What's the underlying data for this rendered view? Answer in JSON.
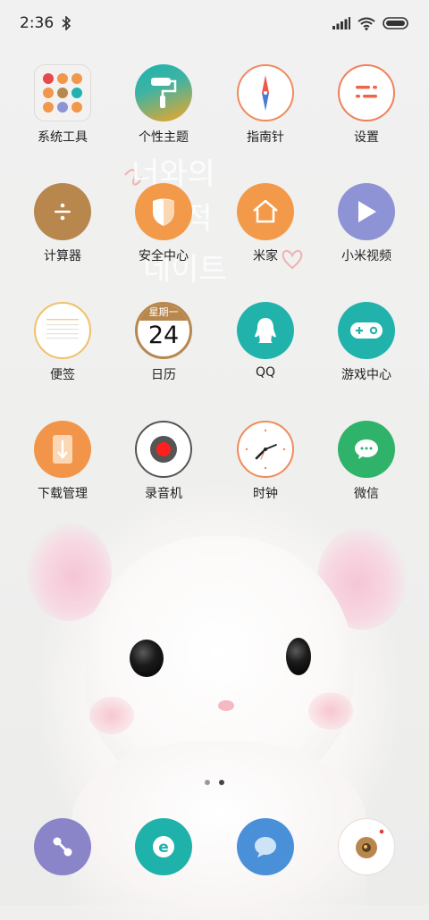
{
  "status_bar": {
    "time": "2:36"
  },
  "apps": [
    {
      "label": "系统工具"
    },
    {
      "label": "个性主题"
    },
    {
      "label": "指南针"
    },
    {
      "label": "设置"
    },
    {
      "label": "计算器"
    },
    {
      "label": "安全中心"
    },
    {
      "label": "米家"
    },
    {
      "label": "小米视频"
    },
    {
      "label": "便签"
    },
    {
      "label": "日历",
      "weekday": "星期一",
      "day": "24"
    },
    {
      "label": "QQ"
    },
    {
      "label": "游戏中心"
    },
    {
      "label": "下载管理"
    },
    {
      "label": "录音机"
    },
    {
      "label": "时钟"
    },
    {
      "label": "微信"
    }
  ],
  "page_indicator": {
    "pages": 2,
    "current": 2
  },
  "dock": [
    {
      "icon": "phone-icon"
    },
    {
      "icon": "browser-icon"
    },
    {
      "icon": "messages-icon"
    },
    {
      "icon": "camera-icon"
    }
  ],
  "wallpaper": {
    "scribble_lines": [
      "너와의",
      "기적",
      "네이트"
    ]
  },
  "colors": {
    "calculator": "#b8874d",
    "security": "#f29a4a",
    "mijia": "#f29a4a",
    "video": "#8e93d6",
    "qq": "#21b3ab",
    "game": "#21b3ab",
    "download": "#f2954a",
    "wechat": "#2fb36a",
    "phone": "#8a84c9",
    "browser": "#1fb2ab",
    "messages": "#4a90d9"
  }
}
